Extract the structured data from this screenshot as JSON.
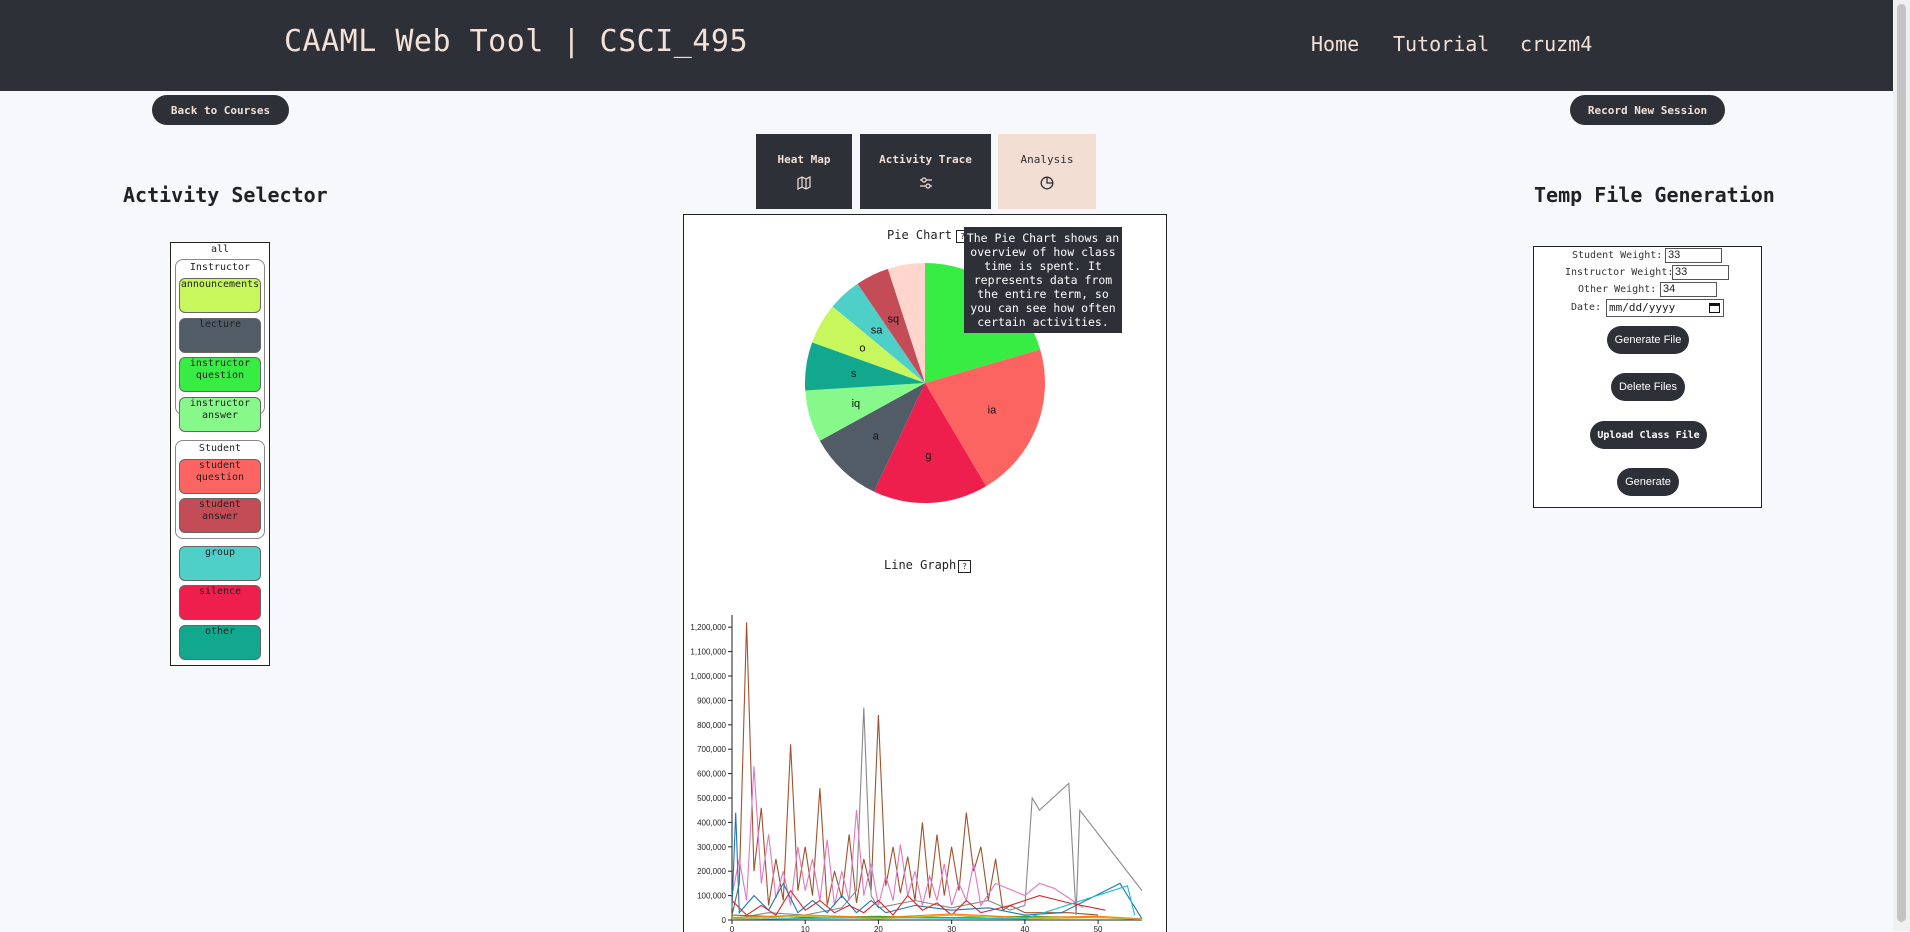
{
  "header": {
    "title": "CAAML Web Tool | CSCI_495",
    "nav": [
      "Home",
      "Tutorial",
      "cruzm4"
    ]
  },
  "buttons": {
    "back": "Back to Courses",
    "record": "Record New Session"
  },
  "activity_selector": {
    "heading": "Activity Selector",
    "all_label": "all",
    "instructor_label": "Instructor",
    "student_label": "Student",
    "instructor_items": [
      {
        "label": "announcements",
        "color": "#c8f65d"
      },
      {
        "label": "lecture",
        "color": "#525c67"
      },
      {
        "label": "instructor question",
        "color": "#37ed43"
      },
      {
        "label": "instructor answer",
        "color": "#86f98a"
      }
    ],
    "student_items": [
      {
        "label": "student question",
        "color": "#fc6461"
      },
      {
        "label": "student answer",
        "color": "#c44c57"
      }
    ],
    "other_items": [
      {
        "label": "group",
        "color": "#4ecfc7"
      },
      {
        "label": "silence",
        "color": "#ef1f4d"
      },
      {
        "label": "other",
        "color": "#12a88e"
      }
    ]
  },
  "tabs": [
    {
      "label": "Heat Map",
      "icon": "map-icon"
    },
    {
      "label": "Activity Trace",
      "icon": "sliders-icon"
    },
    {
      "label": "Analysis",
      "icon": "pie-icon"
    }
  ],
  "pie": {
    "title": "Pie Chart",
    "info": "?",
    "tooltip": "The Pie Chart shows an overview of how class time is spent. It represents data from the entire term, so you can see how often certain activities."
  },
  "line": {
    "title": "Line Graph",
    "info": "?"
  },
  "temp_file": {
    "heading": "Temp File Generation",
    "student_weight_label": "Student Weight:",
    "student_weight": "33",
    "instructor_weight_label": "Instructor Weight:",
    "instructor_weight": "33",
    "other_weight_label": "Other Weight:",
    "other_weight": "34",
    "date_label": "Date:",
    "date_placeholder": "mm/dd/yyyy",
    "generate_file": "Generate File",
    "delete_files": "Delete Files",
    "upload_class_file": "Upload Class File",
    "generate": "Generate"
  },
  "chart_data": [
    {
      "type": "pie",
      "title": "Pie Chart",
      "slices": [
        {
          "label": "l",
          "value": 20.5,
          "color": "#37ed43"
        },
        {
          "label": "ia",
          "value": 21,
          "color": "#fc6461"
        },
        {
          "label": "g",
          "value": 15.5,
          "color": "#ef1f4d"
        },
        {
          "label": "a",
          "value": 10,
          "color": "#525c67"
        },
        {
          "label": "iq",
          "value": 7,
          "color": "#86f98a"
        },
        {
          "label": "s",
          "value": 6.5,
          "color": "#12a88e"
        },
        {
          "label": "o",
          "value": 5.5,
          "color": "#c8f65d"
        },
        {
          "label": "sa",
          "value": 4.5,
          "color": "#4ecfc7"
        },
        {
          "label": "sq",
          "value": 4.5,
          "color": "#c44c57"
        },
        {
          "label": "",
          "value": 5,
          "color": "#ffd5cc"
        }
      ]
    },
    {
      "type": "line",
      "title": "Line Graph",
      "xlim": [
        0,
        56
      ],
      "ylim": [
        0,
        1250000
      ],
      "x_ticks": [
        0,
        10,
        20,
        30,
        40,
        50
      ],
      "y_ticks": [
        0,
        100000,
        200000,
        300000,
        400000,
        500000,
        600000,
        700000,
        800000,
        900000,
        1000000,
        1100000,
        1200000
      ],
      "y_tick_labels": [
        "0",
        "100,000",
        "200,000",
        "300,000",
        "400,000",
        "500,000",
        "600,000",
        "700,000",
        "800,000",
        "900,000",
        "1,000,000",
        "1,100,000",
        "1,200,000"
      ],
      "series": [
        {
          "color": "#a0522d",
          "points": [
            [
              0,
              20000
            ],
            [
              1,
              150000
            ],
            [
              2,
              1220000
            ],
            [
              3,
              200000
            ],
            [
              4,
              460000
            ],
            [
              5,
              60000
            ],
            [
              6,
              250000
            ],
            [
              7,
              80000
            ],
            [
              8,
              720000
            ],
            [
              9,
              120000
            ],
            [
              10,
              300000
            ],
            [
              11,
              100000
            ],
            [
              12,
              540000
            ],
            [
              13,
              60000
            ],
            [
              14,
              200000
            ],
            [
              15,
              90000
            ],
            [
              16,
              350000
            ],
            [
              17,
              70000
            ],
            [
              18,
              250000
            ],
            [
              19,
              120000
            ],
            [
              20,
              840000
            ],
            [
              21,
              140000
            ],
            [
              22,
              300000
            ],
            [
              23,
              110000
            ],
            [
              24,
              260000
            ],
            [
              25,
              80000
            ],
            [
              26,
              400000
            ],
            [
              27,
              90000
            ],
            [
              28,
              350000
            ],
            [
              29,
              100000
            ],
            [
              30,
              300000
            ],
            [
              31,
              120000
            ],
            [
              32,
              440000
            ],
            [
              33,
              200000
            ],
            [
              34,
              300000
            ],
            [
              35,
              80000
            ],
            [
              36,
              250000
            ],
            [
              37,
              40000
            ],
            [
              38,
              60000
            ],
            [
              40,
              30000
            ],
            [
              44,
              30000
            ],
            [
              46,
              30000
            ],
            [
              50,
              20000
            ]
          ]
        },
        {
          "color": "#888888",
          "points": [
            [
              0,
              5000
            ],
            [
              5,
              30000
            ],
            [
              10,
              20000
            ],
            [
              15,
              50000
            ],
            [
              17,
              120000
            ],
            [
              18,
              870000
            ],
            [
              19,
              100000
            ],
            [
              20,
              50000
            ],
            [
              25,
              80000
            ],
            [
              30,
              50000
            ],
            [
              35,
              80000
            ],
            [
              38,
              40000
            ],
            [
              40,
              60000
            ],
            [
              41,
              500000
            ],
            [
              42,
              450000
            ],
            [
              46,
              560000
            ],
            [
              47,
              20000
            ],
            [
              47.5,
              450000
            ],
            [
              56,
              120000
            ]
          ]
        },
        {
          "color": "#e377c2",
          "points": [
            [
              0,
              100000
            ],
            [
              1,
              250000
            ],
            [
              2,
              80000
            ],
            [
              3,
              630000
            ],
            [
              4,
              150000
            ],
            [
              5,
              350000
            ],
            [
              6,
              90000
            ],
            [
              7,
              200000
            ],
            [
              8,
              60000
            ],
            [
              9,
              300000
            ],
            [
              10,
              120000
            ],
            [
              11,
              250000
            ],
            [
              12,
              80000
            ],
            [
              13,
              330000
            ],
            [
              14,
              60000
            ],
            [
              15,
              200000
            ],
            [
              16,
              80000
            ],
            [
              17,
              450000
            ],
            [
              18,
              100000
            ],
            [
              19,
              230000
            ],
            [
              20,
              60000
            ],
            [
              21,
              180000
            ],
            [
              22,
              80000
            ],
            [
              23,
              310000
            ],
            [
              24,
              100000
            ],
            [
              25,
              200000
            ],
            [
              26,
              60000
            ],
            [
              27,
              180000
            ],
            [
              28,
              80000
            ],
            [
              29,
              230000
            ],
            [
              30,
              60000
            ],
            [
              31,
              150000
            ],
            [
              32,
              80000
            ],
            [
              33,
              230000
            ],
            [
              34,
              60000
            ],
            [
              36,
              150000
            ],
            [
              40,
              100000
            ],
            [
              42,
              150000
            ],
            [
              44,
              130000
            ],
            [
              46,
              90000
            ],
            [
              48,
              50000
            ]
          ]
        },
        {
          "color": "#1f77b4",
          "points": [
            [
              0,
              50000
            ],
            [
              0.5,
              440000
            ],
            [
              1,
              30000
            ],
            [
              3,
              100000
            ],
            [
              5,
              40000
            ],
            [
              7,
              150000
            ],
            [
              9,
              30000
            ],
            [
              11,
              80000
            ],
            [
              13,
              30000
            ],
            [
              15,
              100000
            ],
            [
              17,
              30000
            ],
            [
              19,
              80000
            ],
            [
              21,
              30000
            ],
            [
              25,
              60000
            ],
            [
              30,
              40000
            ],
            [
              35,
              50000
            ],
            [
              40,
              20000
            ],
            [
              45,
              30000
            ],
            [
              53,
              150000
            ],
            [
              56,
              5000
            ]
          ]
        },
        {
          "color": "#d62728",
          "points": [
            [
              0,
              80000
            ],
            [
              2,
              20000
            ],
            [
              4,
              60000
            ],
            [
              6,
              20000
            ],
            [
              8,
              120000
            ],
            [
              10,
              40000
            ],
            [
              12,
              80000
            ],
            [
              14,
              30000
            ],
            [
              16,
              60000
            ],
            [
              18,
              30000
            ],
            [
              20,
              80000
            ],
            [
              22,
              20000
            ],
            [
              24,
              100000
            ],
            [
              26,
              40000
            ],
            [
              28,
              70000
            ],
            [
              30,
              20000
            ],
            [
              32,
              80000
            ],
            [
              34,
              30000
            ],
            [
              38,
              60000
            ],
            [
              42,
              100000
            ],
            [
              46,
              70000
            ],
            [
              51,
              40000
            ]
          ]
        },
        {
          "color": "#2ca02c",
          "points": [
            [
              0,
              20000
            ],
            [
              10,
              10000
            ],
            [
              20,
              15000
            ],
            [
              30,
              10000
            ],
            [
              40,
              15000
            ],
            [
              50,
              10000
            ],
            [
              56,
              5000
            ]
          ]
        },
        {
          "color": "#ff7f0e",
          "points": [
            [
              0,
              10000
            ],
            [
              10,
              20000
            ],
            [
              20,
              10000
            ],
            [
              30,
              25000
            ],
            [
              40,
              10000
            ],
            [
              50,
              15000
            ],
            [
              56,
              5000
            ]
          ]
        },
        {
          "color": "#bcbd22",
          "points": [
            [
              0,
              5000
            ],
            [
              10,
              15000
            ],
            [
              20,
              5000
            ],
            [
              30,
              20000
            ],
            [
              40,
              5000
            ],
            [
              50,
              10000
            ],
            [
              56,
              2000
            ]
          ]
        },
        {
          "color": "#17becf",
          "points": [
            [
              0,
              2000
            ],
            [
              20,
              10000
            ],
            [
              40,
              5000
            ],
            [
              54,
              140000
            ],
            [
              55,
              20000
            ]
          ]
        }
      ]
    }
  ]
}
